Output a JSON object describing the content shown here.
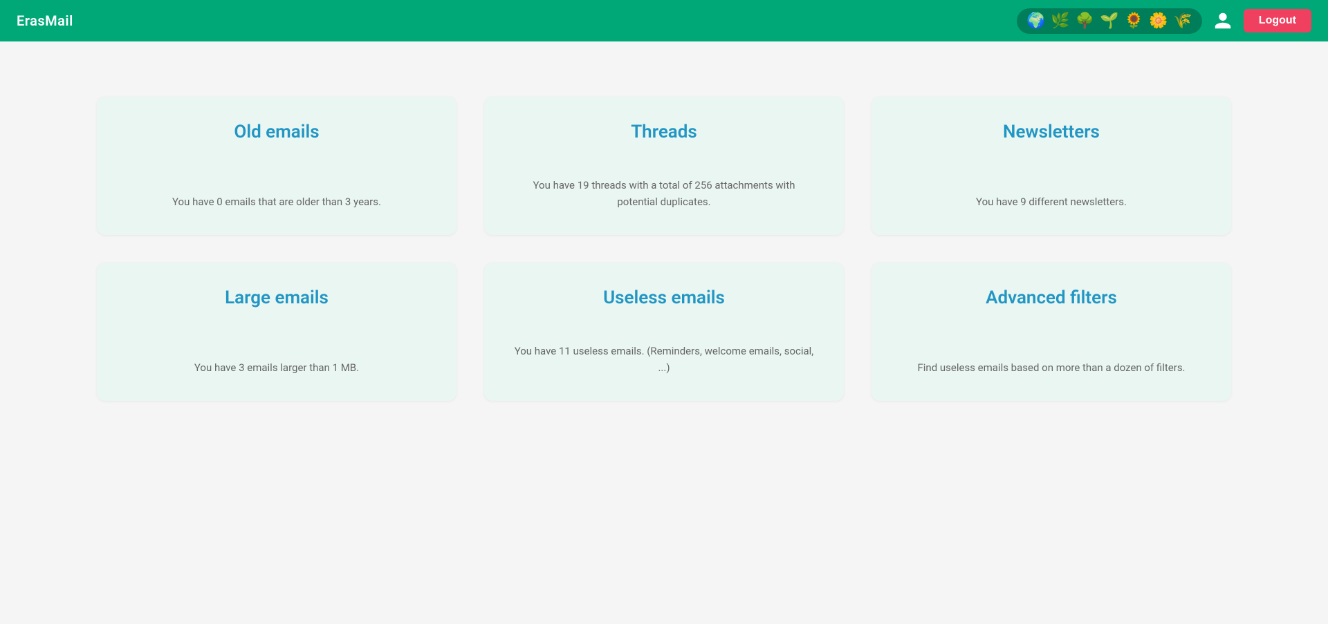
{
  "brand": "ErasMail",
  "navbar": {
    "emojis": [
      "🌍",
      "🌿",
      "🌳",
      "🌱",
      "🌻",
      "🌼",
      "🌾"
    ],
    "logout_label": "Logout"
  },
  "cards": [
    {
      "id": "old-emails",
      "title": "Old emails",
      "description": "You have 0 emails that are older than 3 years."
    },
    {
      "id": "threads",
      "title": "Threads",
      "description": "You have 19 threads with a total of 256 attachments with potential duplicates."
    },
    {
      "id": "newsletters",
      "title": "Newsletters",
      "description": "You have 9 different newsletters."
    },
    {
      "id": "large-emails",
      "title": "Large emails",
      "description": "You have 3 emails larger than 1 MB."
    },
    {
      "id": "useless-emails",
      "title": "Useless emails",
      "description": "You have 11 useless emails. (Reminders, welcome emails, social, ...)"
    },
    {
      "id": "advanced-filters",
      "title": "Advanced filters",
      "description": "Find useless emails based on more than a dozen of filters."
    }
  ]
}
